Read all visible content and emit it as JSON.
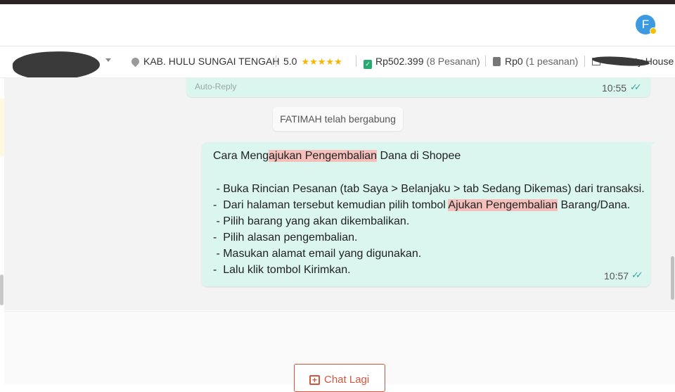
{
  "header": {
    "avatar_initial": "F"
  },
  "shop_info": {
    "location": "KAB. HULU SUNGAI TENGAH",
    "rating": "5.0",
    "rating_stars": 5,
    "paid_amount": "Rp502.399",
    "paid_orders": "(8 Pesanan)",
    "pending_amount": "Rp0",
    "pending_orders": "(1 pesanan)",
    "shop_name_partial": "ty House"
  },
  "chat": {
    "prev_message": {
      "label": "Auto-Reply",
      "time": "10:55"
    },
    "system_message": "FATIMAH telah bergabung",
    "message": {
      "title_before": "Cara Meng",
      "title_highlight": "ajukan Pengembalian",
      "title_after": " Dana di Shopee",
      "line1": " - Buka Rincian Pesanan (tab Saya > Belanjaku > tab Sedang Dikemas) dari transaksi.",
      "line2_before": "-  Dari halaman tersebut kemudian pilih tombol ",
      "line2_highlight": "Ajukan Pengembalian",
      "line2_after": " Barang/Dana.",
      "line3": " - Pilih barang yang akan dikembalikan.",
      "line4": "-  Pilih alasan pengembalian.",
      "line5": " - Masukan alamat email yang digunakan.",
      "line6": "-  Lalu klik tombol Kirimkan.",
      "time": "10:57"
    }
  },
  "footer": {
    "chat_again_label": "Chat Lagi"
  },
  "colors": {
    "bubble": "#dbf6ee",
    "highlight": "#f5c0bc",
    "accent": "#d3543f",
    "star": "#f7b500"
  }
}
